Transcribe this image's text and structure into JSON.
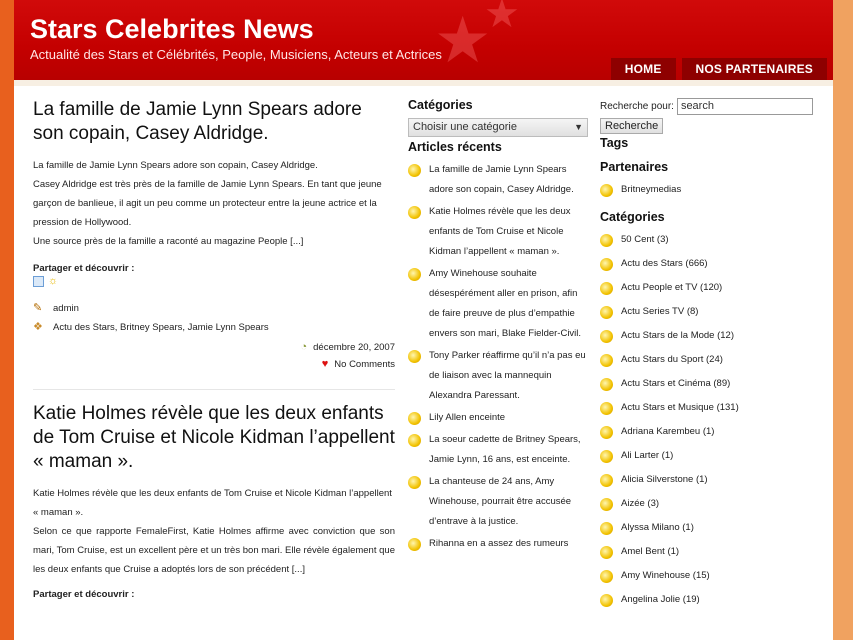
{
  "site": {
    "title": "Stars Celebrites News",
    "tagline": "Actualité des Stars et Célébrités, People, Musiciens, Acteurs et Actrices"
  },
  "nav": [
    {
      "label": "HOME"
    },
    {
      "label": "NOS PARTENAIRES"
    }
  ],
  "posts": [
    {
      "title": "La famille de Jamie Lynn Spears adore son copain, Casey Aldridge.",
      "paragraphs": [
        "La famille de Jamie Lynn Spears adore son copain, Casey Aldridge.",
        "Casey Aldridge est très près de la famille de Jamie Lynn Spears. En tant que jeune garçon de banlieue, il agit un peu comme un protecteur entre la jeune actrice et la pression de Hollywood.",
        "Une source près de la famille a raconté au magazine People [...]"
      ],
      "share_label": "Partager et découvrir :",
      "author": "admin",
      "categories": "Actu des Stars, Britney Spears, Jamie Lynn Spears",
      "date": "décembre 20, 2007",
      "comments": "No Comments"
    },
    {
      "title": "Katie Holmes révèle que les deux enfants de Tom Cruise et Nicole Kidman l’appellent « maman ».",
      "paragraphs": [
        "Katie Holmes révèle que les deux enfants de Tom Cruise et Nicole Kidman l’appellent « maman ».",
        "Selon ce que rapporte FemaleFirst, Katie Holmes affirme avec conviction que son mari, Tom Cruise, est un excellent père et un très bon mari. Elle révèle également que les deux enfants que Cruise a adoptés lors de son précédent [...]"
      ],
      "share_label": "Partager et découvrir :"
    }
  ],
  "sidebar_left": {
    "categories_heading": "Catégories",
    "select_value": "Choisir une catégorie",
    "recent_heading": "Articles récents",
    "recent": [
      "La famille de Jamie Lynn Spears adore son copain, Casey Aldridge.",
      "Katie Holmes révèle que les deux enfants de Tom Cruise et Nicole Kidman l’appellent « maman ».",
      "Amy Winehouse souhaite désespérément aller en prison, afin de faire preuve de plus d’empathie envers son mari, Blake Fielder-Civil.",
      "Tony Parker réaffirme qu’il n’a pas eu de liaison avec la mannequin Alexandra Paressant.",
      "Lily Allen enceinte",
      "La soeur cadette de Britney Spears, Jamie Lynn, 16 ans, est enceinte.",
      "La chanteuse de 24 ans, Amy Winehouse, pourrait être accusée d’entrave à la justice.",
      "Rihanna en a assez des rumeurs"
    ]
  },
  "sidebar_right": {
    "search_label": "Recherche pour:",
    "search_value": "search",
    "search_button": "Recherche",
    "tags_heading": "Tags",
    "partners_heading": "Partenaires",
    "partners": [
      "Britneymedias"
    ],
    "categories_heading": "Catégories",
    "categories": [
      "50 Cent (3)",
      "Actu des Stars (666)",
      "Actu People et TV (120)",
      "Actu Series TV (8)",
      "Actu Stars de la Mode (12)",
      "Actu Stars du Sport (24)",
      "Actu Stars et Cinéma (89)",
      "Actu Stars et Musique (131)",
      "Adriana Karembeu (1)",
      "Ali Larter (1)",
      "Alicia Silverstone (1)",
      "Aizée (3)",
      "Alyssa Milano (1)",
      "Amel Bent (1)",
      "Amy Winehouse (15)",
      "Angelina Jolie (19)"
    ]
  },
  "colors": {
    "header_red": "#c40000",
    "nav_dark_red": "#8e0000",
    "bullet_yellow": "#f2c200"
  }
}
